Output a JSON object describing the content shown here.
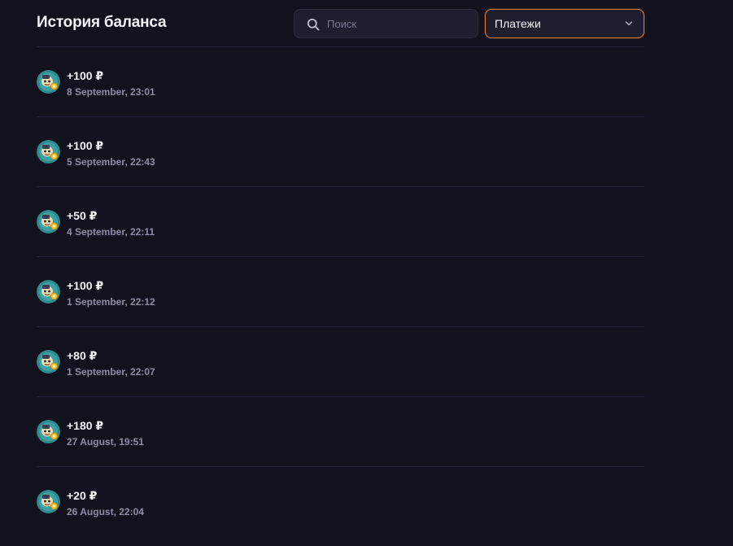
{
  "header": {
    "title": "История баланса",
    "search": {
      "placeholder": "Поиск",
      "value": ""
    },
    "filter": {
      "selected": "Платежи"
    }
  },
  "icons": {
    "search": "search-icon",
    "dropdown": "chevron-down-icon",
    "avatar": "avatar-icon"
  },
  "colors": {
    "background": "#12121f",
    "accent": "#e07a2e",
    "text": "#f2f2f7",
    "muted": "#8c8ca4"
  },
  "transactions": [
    {
      "amount": "+100 ₽",
      "date": "8 September, 23:01"
    },
    {
      "amount": "+100 ₽",
      "date": "5 September, 22:43"
    },
    {
      "amount": "+50 ₽",
      "date": "4 September, 22:11"
    },
    {
      "amount": "+100 ₽",
      "date": "1 September, 22:12"
    },
    {
      "amount": "+80 ₽",
      "date": "1 September, 22:07"
    },
    {
      "amount": "+180 ₽",
      "date": "27 August, 19:51"
    },
    {
      "amount": "+20 ₽",
      "date": "26 August, 22:04"
    }
  ]
}
